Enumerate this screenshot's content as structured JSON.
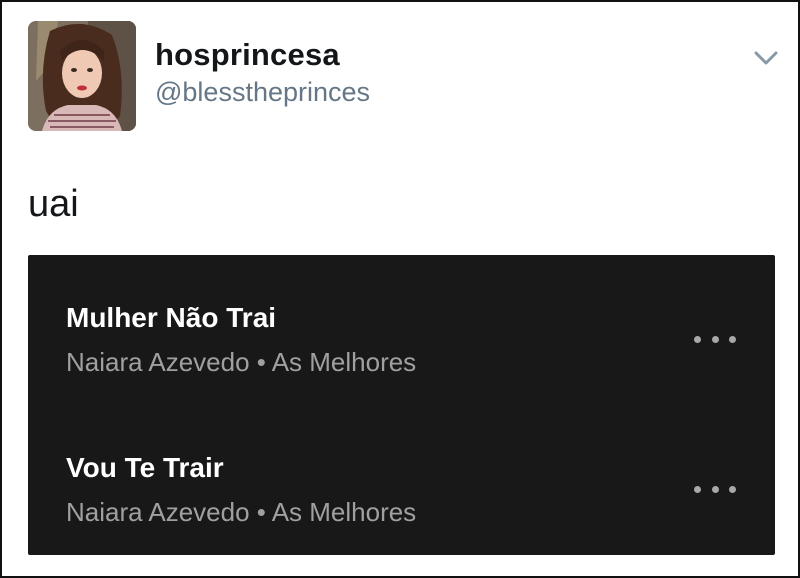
{
  "tweet": {
    "display_name": "hosprincesa",
    "handle": "@blesstheprinces",
    "text": "uai",
    "caret_icon": "chevron-down-icon"
  },
  "player": {
    "tracks": [
      {
        "title": "Mulher Não Trai",
        "artist": "Naiara Azevedo",
        "separator": " • ",
        "album": "As Melhores",
        "more_icon": "more-options-icon"
      },
      {
        "title": "Vou Te Trair",
        "artist": "Naiara Azevedo",
        "separator": " • ",
        "album": "As Melhores",
        "more_icon": "more-options-icon"
      }
    ]
  },
  "colors": {
    "name": "#14171a",
    "handle": "#657786",
    "player_bg": "#181818",
    "track_title": "#ffffff",
    "track_meta": "#a0a0a0"
  }
}
